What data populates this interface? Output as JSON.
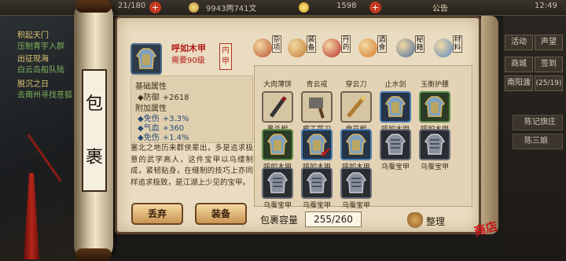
{
  "topbar": {
    "energy": "21/180",
    "silver": "9943两741文",
    "gold": "1598",
    "notice_label": "公告",
    "time": "12:49"
  },
  "quests": [
    {
      "title": "积起天门",
      "desc": "压制青宇入群"
    },
    {
      "title": "出征现海",
      "desc": "白云岛船队陆"
    },
    {
      "title": "脱沉之日",
      "desc": "去南州寻找苍狐"
    }
  ],
  "right_menu": {
    "btn1": "活动",
    "btn2": "声望",
    "btn3": "商城",
    "btn4": "签到",
    "location": "南阳渡",
    "location_count": "(25/19)",
    "list1": "陈记旗庄",
    "list2": "陈三娘"
  },
  "scroll_title": [
    "包",
    "裹"
  ],
  "item": {
    "name": "呼如木甲",
    "requirement": "需要90级",
    "slot": "内甲",
    "base_header": "基础属性",
    "base_stats": [
      {
        "key": "◆防御",
        "value": "+2618"
      }
    ],
    "extra_header": "附加属性",
    "extra_stats": [
      {
        "key": "◆免伤",
        "value": "+3.3%"
      },
      {
        "key": "◆气血",
        "value": "+360"
      },
      {
        "key": "◆免伤",
        "value": "+1.4%"
      }
    ],
    "description": "塞北之地历来群侠辈出，多是追求极意的武学高人，这件宝甲以乌缕制成，紧韧贴身，在缝制的技巧上亦同样追求极致，是江湖上少见的宝甲。"
  },
  "buttons": {
    "discard": "丢弃",
    "equip": "装备"
  },
  "tabs": [
    {
      "label": "杂项",
      "color": "#b8502c"
    },
    {
      "label": "装备",
      "color": "#c07830"
    },
    {
      "label": "丹药",
      "color": "#b82c2c"
    },
    {
      "label": "酒食",
      "color": "#d67a2a"
    },
    {
      "label": "秘籍",
      "color": "#4a6ca0"
    },
    {
      "label": "材料",
      "color": "#5a88c4"
    }
  ],
  "grid_top_labels": [
    "大肉薄饼",
    "青云戒",
    "穿云刀",
    "止水剑",
    "玉衡护腰"
  ],
  "grid": [
    {
      "label": "黑杀棍",
      "style": "plain",
      "icon": "dark-staff-icon"
    },
    {
      "label": "庖丁菜刀",
      "style": "plain",
      "icon": "cleaver-icon"
    },
    {
      "label": "盘花棍",
      "style": "plain",
      "icon": "flower-staff-icon"
    },
    {
      "label": "呼如木甲",
      "style": "blue",
      "icon": "armor-icon"
    },
    {
      "label": "呼如木甲",
      "style": "green",
      "icon": "armor-icon"
    },
    {
      "label": "呼如木甲",
      "style": "green",
      "icon": "armor-icon"
    },
    {
      "label": "呼如木甲",
      "style": "blue",
      "icon": "armor-icon",
      "selected": true
    },
    {
      "label": "呼如木甲",
      "style": "blue",
      "icon": "armor-icon"
    },
    {
      "label": "乌蚕宝甲",
      "style": "gray",
      "icon": "silk-armor-icon"
    },
    {
      "label": "乌蚕宝甲",
      "style": "gray",
      "icon": "silk-armor-icon"
    },
    {
      "label": "乌蚕宝甲",
      "style": "gray",
      "icon": "silk-armor-icon"
    },
    {
      "label": "乌蚕宝甲",
      "style": "gray",
      "icon": "silk-armor-icon"
    },
    {
      "label": "乌蚕宝甲",
      "style": "gray",
      "icon": "silk-armor-icon"
    }
  ],
  "capacity": {
    "label": "包裹容量",
    "value": "255/260"
  },
  "sort_label": "整理",
  "shop_stamp": "商店"
}
